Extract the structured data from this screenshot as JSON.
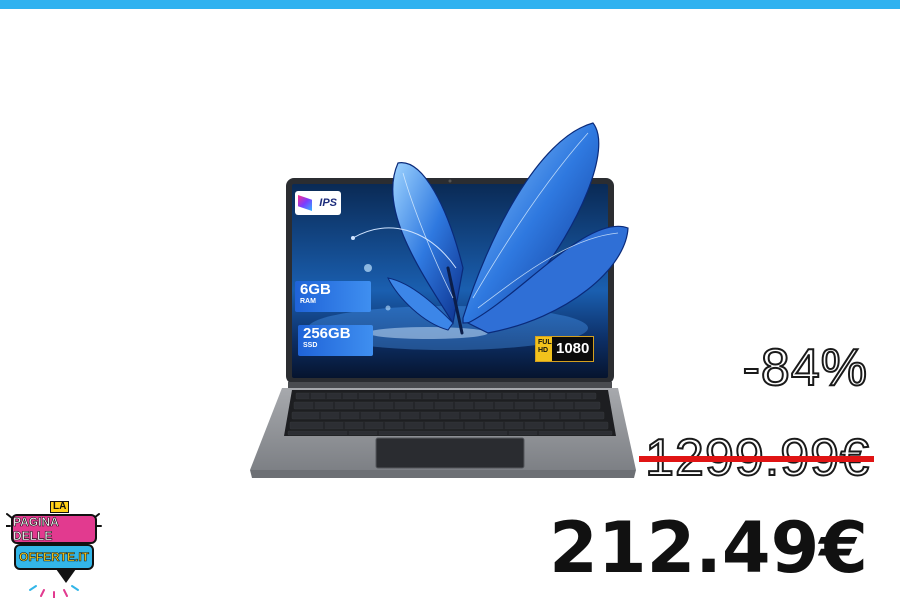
{
  "banner": {
    "accent_color": "#2fb2f0"
  },
  "product": {
    "image_icon": "laptop-with-butterfly-screen-image",
    "badges": {
      "ips": "IPS",
      "ram_size": "6GB",
      "ram_label": "RAM",
      "ssd_size": "256GB",
      "ssd_label": "SSD",
      "fullhd_label_1": "FULL",
      "fullhd_label_2": "HD",
      "resolution": "1080"
    }
  },
  "pricing": {
    "discount": "-84%",
    "original_price": "1299.99€",
    "sale_price": "212.49€",
    "strike_color": "#e01414"
  },
  "logo": {
    "prefix": "LA",
    "line1": "PAGINA DELLE",
    "line2": "OFFERTE.IT",
    "colors": {
      "pink": "#e23a8f",
      "blue": "#33b6e8",
      "yellow": "#ffd11a"
    }
  }
}
